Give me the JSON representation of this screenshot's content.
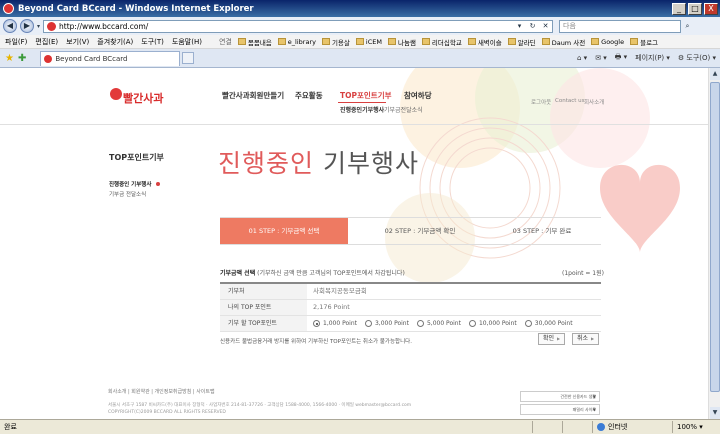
{
  "window": {
    "title": "Beyond Card BCcard - Windows Internet Explorer",
    "min": "_",
    "max": "□",
    "close": "X"
  },
  "address": {
    "url": "http://www.bccard.com/",
    "search_placeholder": "다음",
    "refresh": "↻",
    "stop": "✕"
  },
  "menu": {
    "items": [
      "파일(F)",
      "편집(E)",
      "보기(V)",
      "즐겨찾기(A)",
      "도구(T)",
      "도움말(H)"
    ],
    "links_label": "연결",
    "links": [
      "몸몸내음",
      "e_library",
      "기용살",
      "iCEM",
      "나눔쌤",
      "리더십학교",
      "새벽이슬",
      "알라딘",
      "Daum 사전",
      "Google",
      "블로그"
    ]
  },
  "tabs": {
    "active_tab": "Beyond Card BCcard",
    "commands": [
      "⌂ ▾",
      "✉ ▾",
      "🖶 ▾",
      "페이지(P) ▾",
      "⚙ 도구(O) ▾"
    ]
  },
  "site": {
    "logo_text": "빨간사과",
    "gnb": [
      "빨간사과회원만들기",
      "주요활동",
      "TOP포인트기부",
      "참여하당"
    ],
    "subnav": [
      "진행중인기부행사",
      "기부금전달소식"
    ],
    "util": [
      "로그아웃",
      "Contact us",
      "회사소개"
    ],
    "lnb_title": "TOP포인트기부",
    "lnb_items": [
      "진행중인 기부행사",
      "기부금 전달소식"
    ],
    "page_title_hl": "진행중인",
    "page_title_rest": " 기부행사",
    "steps": [
      "01 STEP : 기부금액 선택",
      "02 STEP : 기부금액 확인",
      "03 STEP : 기부 완료"
    ],
    "section_title": "기부금액 선택",
    "section_desc": " (기부하신 금액 만큼 고객님의 TOP포인트에서 차감됩니다)",
    "section_note": "(1point = 1원)",
    "rows": {
      "org_label": "기부처",
      "org_value": "사회복지공동모금회",
      "points_label": "나의 TOP 포인트",
      "points_value": "2,176 Point",
      "amount_label": "기부 할 TOP포인트",
      "amount_options": [
        "1,000 Point",
        "3,000 Point",
        "5,000 Point",
        "10,000 Point",
        "30,000 Point"
      ],
      "selected_index": 0
    },
    "notice": "신용카드 불법금융거래 방지를 위하여 기부하신 TOP포인트는 취소가 불가능합니다.",
    "btn_ok": "확인",
    "btn_cancel": "취소",
    "footer_links": "회사소개  |  회원약관  |  개인정보취급방침  |  사이트맵",
    "footer_addr1": "서울시 서초구 1587 비씨카드(주) 대표이사 장형덕 · 사업자번호 214-81-37726 · 고객상담 1588-4000, 1566-4000 · 이메일 webmaster@bccard.com",
    "footer_addr2": "COPYRIGHT(C)2009 BCCARD ALL RIGHTS RESERVED",
    "footer_sel1": "건전한 신용카드 생활",
    "footer_sel2": "패밀리 사이트"
  },
  "status": {
    "left": "완료",
    "zone": "인터넷",
    "zoom": "100%"
  },
  "colors": {
    "accent": "#e05b5b",
    "step_active": "#ee7a62"
  }
}
